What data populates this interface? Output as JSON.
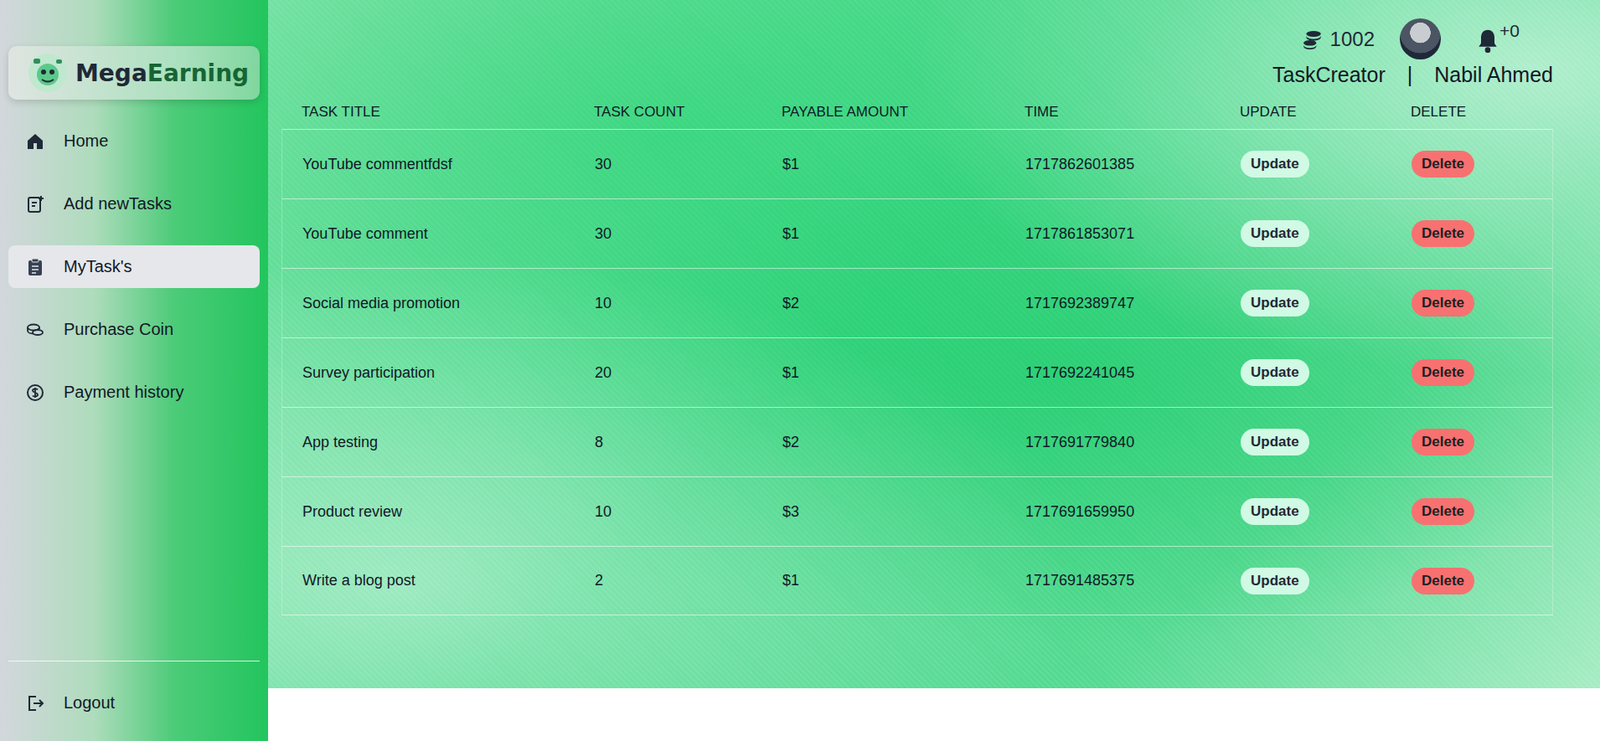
{
  "sidebar": {
    "brand": {
      "first": "Mega",
      "second": "Earning"
    },
    "items": [
      {
        "label": "Home",
        "selected": false
      },
      {
        "label": "Add newTasks",
        "selected": false
      },
      {
        "label": "MyTask's",
        "selected": true
      },
      {
        "label": "Purchase Coin",
        "selected": false
      },
      {
        "label": "Payment history",
        "selected": false
      }
    ],
    "logout": "Logout"
  },
  "header": {
    "coins": "1002",
    "notifications": "+0",
    "role": "TaskCreator",
    "separator": "|",
    "user": "Nabil Ahmed"
  },
  "table": {
    "columns": [
      "TASK TITLE",
      "TASK COUNT",
      "PAYABLE AMOUNT",
      "TIME",
      "UPDATE",
      "DELETE"
    ],
    "rows": [
      {
        "title": "YouTube commentfdsf",
        "count": "30",
        "amount": "$1",
        "time": "1717862601385",
        "update": "Update",
        "delete": "Delete"
      },
      {
        "title": "YouTube comment",
        "count": "30",
        "amount": "$1",
        "time": "1717861853071",
        "update": "Update",
        "delete": "Delete"
      },
      {
        "title": "Social media promotion",
        "count": "10",
        "amount": "$2",
        "time": "1717692389747",
        "update": "Update",
        "delete": "Delete"
      },
      {
        "title": "Survey participation",
        "count": "20",
        "amount": "$1",
        "time": "1717692241045",
        "update": "Update",
        "delete": "Delete"
      },
      {
        "title": "App testing",
        "count": "8",
        "amount": "$2",
        "time": "1717691779840",
        "update": "Update",
        "delete": "Delete"
      },
      {
        "title": "Product review",
        "count": "10",
        "amount": "$3",
        "time": "1717691659950",
        "update": "Update",
        "delete": "Delete"
      },
      {
        "title": "Write a blog post",
        "count": "2",
        "amount": "$1",
        "time": "1717691485375",
        "update": "Update",
        "delete": "Delete"
      }
    ]
  }
}
